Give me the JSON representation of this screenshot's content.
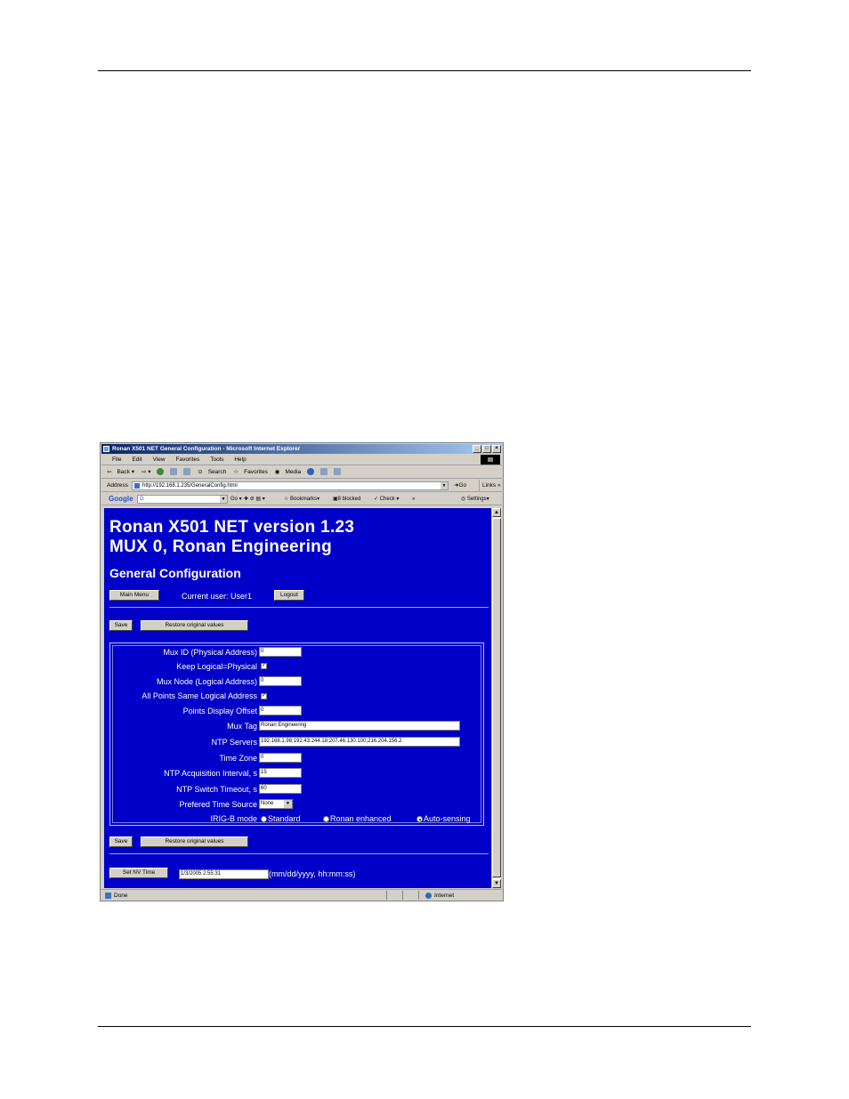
{
  "window": {
    "title": "Ronan X501 NET General Configuration - Microsoft Internet Explorer",
    "controls": {
      "minimize": "_",
      "maximize": "□",
      "close": "×"
    }
  },
  "menubar": [
    "File",
    "Edit",
    "View",
    "Favorites",
    "Tools",
    "Help"
  ],
  "toolbar": {
    "back": "Back",
    "search": "Search",
    "favorites": "Favorites",
    "media": "Media"
  },
  "addressbar": {
    "label": "Address",
    "url": "http://192.168.1.235/GeneralConfig.html",
    "go": "Go",
    "links": "Links"
  },
  "googlebar": {
    "logo": "Google",
    "search_value": "G",
    "go": "Go",
    "bookmarks": "Bookmarks",
    "blocked": "8 blocked",
    "check": "Check",
    "settings": "Settings"
  },
  "page": {
    "heading_line1": "Ronan X501 NET version 1.23",
    "heading_line2": "MUX 0, Ronan Engineering",
    "section_title": "General Configuration",
    "main_menu_button": "Main Menu",
    "current_user": "Current user: User1",
    "logout_button": "Logout",
    "save_button": "Save",
    "restore_button": "Restore original values",
    "fields": {
      "mux_id": {
        "label": "Mux ID (Physical Address)",
        "value": "0"
      },
      "keep_logical": {
        "label": "Keep Logical=Physical",
        "checked": true
      },
      "mux_node": {
        "label": "Mux Node (Logical Address)",
        "value": "0"
      },
      "all_points": {
        "label": "All Points Same Logical Address",
        "checked": true
      },
      "points_offset": {
        "label": "Points Display Offset",
        "value": "0"
      },
      "mux_tag": {
        "label": "Mux Tag",
        "value": "Ronan Engineering"
      },
      "ntp_servers": {
        "label": "NTP Servers",
        "value": "192.168.1.98;192.43.244.18;207.46.130.100;216.204.156.2"
      },
      "time_zone": {
        "label": "Time Zone",
        "value": "0"
      },
      "ntp_acq": {
        "label": "NTP Acquisition Interval, s",
        "value": "15"
      },
      "ntp_switch": {
        "label": "NTP Switch Timeout, s",
        "value": "60"
      },
      "pref_source": {
        "label": "Prefered Time Source",
        "value": "None"
      },
      "irig_mode": {
        "label": "IRIG-B mode",
        "options": [
          "Standard",
          "Ronan enhanced",
          "Auto-sensing"
        ],
        "selected": "Auto-sensing"
      }
    },
    "set_nv_time_button": "Set NV Time",
    "nv_time_value": "1/3/2005 2:55:31",
    "nv_time_format": "(mm/dd/yyyy, hh:mm:ss)"
  },
  "statusbar": {
    "status": "Done",
    "zone": "Internet"
  }
}
